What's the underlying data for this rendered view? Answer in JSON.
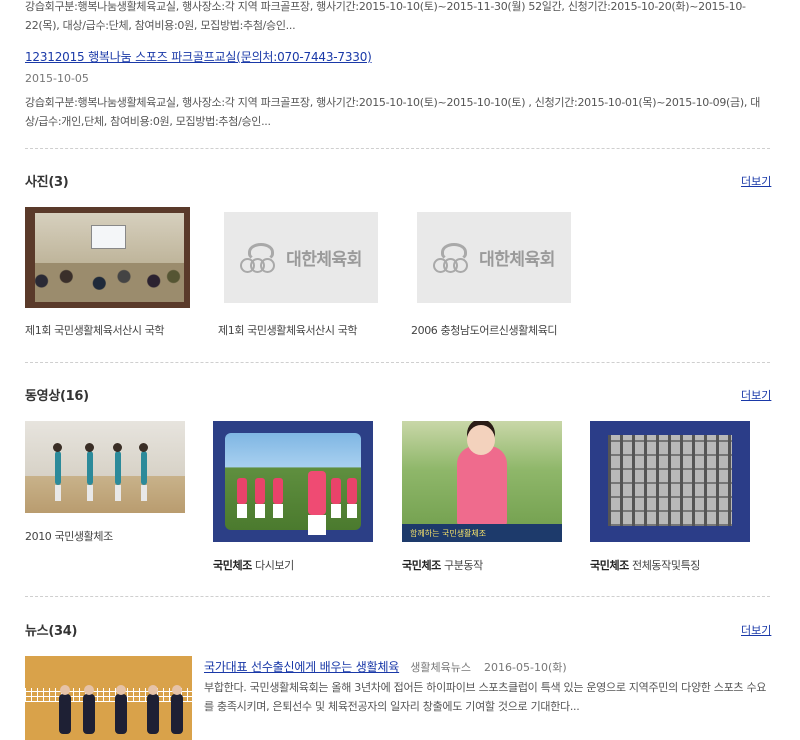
{
  "events": [
    {
      "desc": "강습회구분:행복나눔생활체육교실, 행사장소:각 지역 파크골프장, 행사기간:2015-10-10(토)~2015-11-30(월) 52일간, 신청기간:2015-10-20(화)~2015-10-22(목), 대상/급수:단체, 참여비용:0원, 모집방법:추첨/승인..."
    },
    {
      "title": "12312015 행복나눔 스포즈 파크골프교실(문의처:070-7443-7330)",
      "date": "2015-10-05",
      "desc": "강습회구분:행복나눔생활체육교실, 행사장소:각 지역 파크골프장, 행사기간:2015-10-10(토)~2015-10-10(토) , 신청기간:2015-10-01(목)~2015-10-09(금), 대상/급수:개인,단체, 참여비용:0원, 모집방법:추첨/승인..."
    }
  ],
  "photos": {
    "title": "사진(3)",
    "more": "더보기",
    "items": [
      {
        "caption": "제1회 국민생활체육서산시 국학"
      },
      {
        "caption": "제1회 국민생활체육서산시 국학",
        "logo_text": "대한체육회"
      },
      {
        "caption": "2006 충청남도어르신생활체육디",
        "logo_text": "대한체육회"
      }
    ]
  },
  "videos": {
    "title": "동영상(16)",
    "more": "더보기",
    "items": [
      {
        "caption": "2010 국민생활체조"
      },
      {
        "caption_bold": "국민체조",
        "caption_rest": " 다시보기"
      },
      {
        "caption_bold": "국민체조",
        "caption_rest": " 구분동작",
        "banner": "함께하는 국민생활체조"
      },
      {
        "caption_bold": "국민체조",
        "caption_rest": " 전체동작및특징"
      }
    ]
  },
  "news": {
    "title": "뉴스(34)",
    "more": "더보기",
    "item": {
      "headline": "국가대표 선수출신에게 배우는 생활체육",
      "source": "생활체육뉴스",
      "date": "2016-05-10(화)",
      "summary": "부합한다. 국민생활체육회는 올해 3년차에 접어든 하이파이브 스포츠클럽이 특색 있는 운영으로 지역주민의 다양한 스포츠 수요를 충족시키며, 은퇴선수 및 체육전공자의 일자리 창출에도 기여할 것으로 기대한다..."
    }
  }
}
